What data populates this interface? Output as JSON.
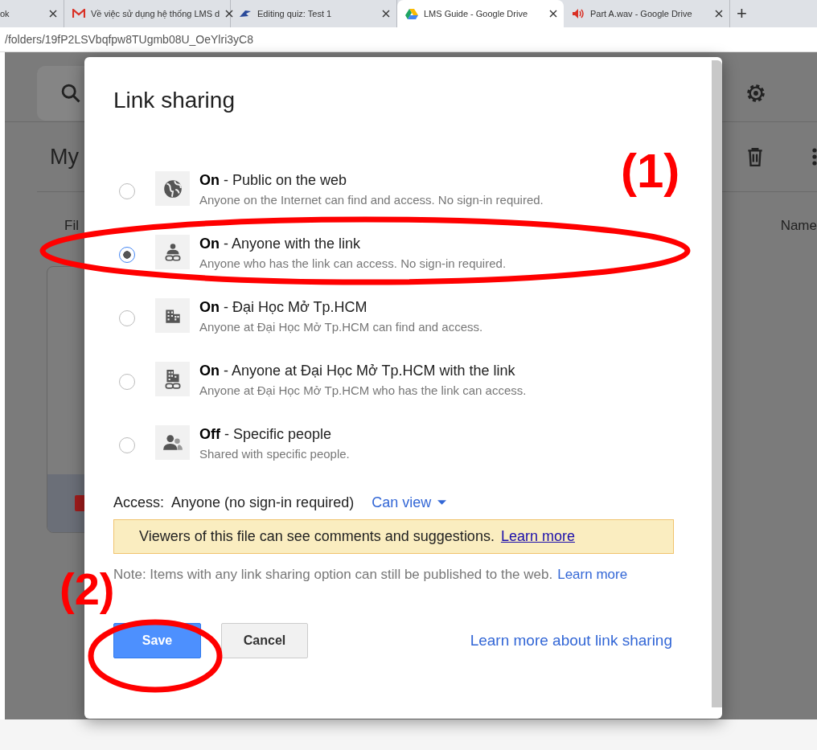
{
  "browser": {
    "tabs": [
      {
        "kind": "plain",
        "label": "ok",
        "selected": false
      },
      {
        "kind": "mail",
        "label": "Về việc sử dụng hệ thống LMS d",
        "selected": false
      },
      {
        "kind": "quiz",
        "label": "Editing quiz: Test 1",
        "selected": false
      },
      {
        "kind": "drive",
        "label": "LMS Guide - Google Drive",
        "selected": true
      },
      {
        "kind": "audio",
        "label": "Part A.wav - Google Drive",
        "selected": false
      }
    ],
    "new_tab": "+",
    "address": "/folders/19fP2LSVbqfpw8TUgmb08U_OeYlri3yC8"
  },
  "background": {
    "heading": "My",
    "column_label": "Fil",
    "name_column": "Name"
  },
  "dialog": {
    "title": "Link sharing",
    "options": [
      {
        "kind": "globe",
        "title": "**On** - Public on the web",
        "description": "Anyone on the Internet can find and access. No sign-in required.",
        "selected": false
      },
      {
        "kind": "person-link",
        "title": "**On** - Anyone with the link",
        "description": "Anyone who has the link can access. No sign-in required.",
        "selected": true
      },
      {
        "kind": "building",
        "title": "**On** - Đại Học Mở Tp.HCM",
        "description": "Anyone at Đại Học Mở Tp.HCM can find and access.",
        "selected": false
      },
      {
        "kind": "building-link",
        "title": "**On** - Anyone at Đại Học Mở Tp.HCM with the link",
        "description": "Anyone at Đại Học Mở Tp.HCM who has the link can access.",
        "selected": false
      },
      {
        "kind": "people",
        "title": "**Off** - Specific people",
        "description": "Shared with specific people.",
        "selected": false
      }
    ],
    "access_label": "Access:",
    "access_value": "Anyone (no sign-in required)",
    "permission": "Can view",
    "banner": {
      "text": "Viewers of this file can see comments and suggestions.",
      "link": "Learn more"
    },
    "note": {
      "text": "Note: Items with any link sharing option can still be published to the web.",
      "link": "Learn more"
    },
    "buttons": [
      {
        "kind": "primary",
        "label": "Save"
      },
      {
        "kind": "secondary",
        "label": "Cancel"
      }
    ],
    "footer_link": "Learn more about link sharing"
  },
  "annotations": [
    {
      "label": "(1)"
    },
    {
      "label": "(2)"
    }
  ]
}
